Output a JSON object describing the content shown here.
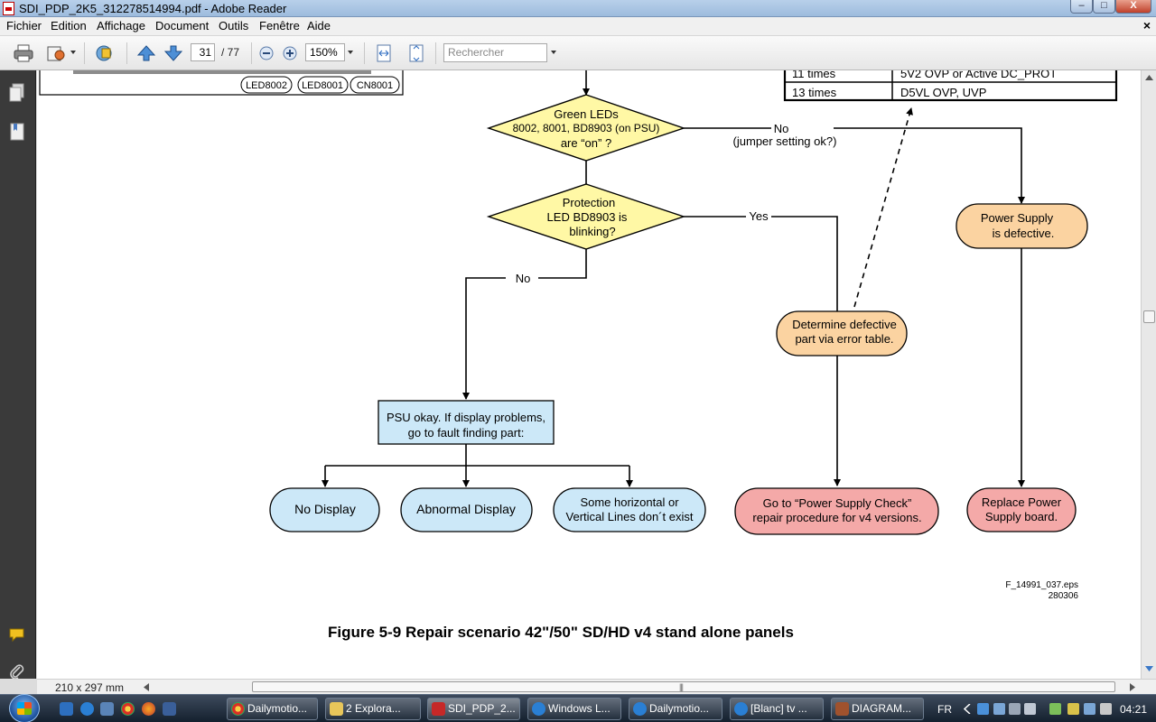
{
  "window": {
    "title": "SDI_PDP_2K5_312278514994.pdf - Adobe Reader",
    "min_label": "‒",
    "max_label": "□",
    "close_label": "X"
  },
  "menu": {
    "items": [
      "Fichier",
      "Edition",
      "Affichage",
      "Document",
      "Outils",
      "Fenêtre",
      "Aide"
    ],
    "close_label": "×"
  },
  "toolbar": {
    "page_current": "31",
    "page_total": "/ 77",
    "zoom": "150%",
    "search_placeholder": "Rechercher"
  },
  "document": {
    "top_table": [
      {
        "count": "11 times",
        "desc": "5V2 OVP or Active DC_PROT"
      },
      {
        "count": "13 times",
        "desc": "D5VL OVP, UVP"
      }
    ],
    "led_labels": [
      "LED8002",
      "LED8001",
      "CN8001"
    ],
    "diamond_green": [
      "Green LEDs",
      "8002, 8001, BD8903 (on PSU)",
      "are “on” ?"
    ],
    "diamond_protection": [
      "Protection",
      "LED BD8903 is",
      "blinking?"
    ],
    "label_no_jumper": [
      "No",
      "(jumper setting ok?)"
    ],
    "label_yes": "Yes",
    "label_no": "No",
    "power_supply_defective": [
      "Power Supply",
      "is defective."
    ],
    "determine_defective": [
      "Determine defective",
      "part via error table."
    ],
    "psu_okay": [
      "PSU okay. If display problems,",
      "go to fault finding part:"
    ],
    "no_display": "No Display",
    "abnormal_display": "Abnormal Display",
    "lines": [
      "Some horizontal or",
      "Vertical Lines don´t exist"
    ],
    "go_to_check": [
      "Go to “Power Supply Check”",
      "repair procedure for v4 versions."
    ],
    "replace_board": [
      "Replace Power",
      "Supply  board."
    ],
    "file_ref": [
      "F_14991_037.eps",
      "280306"
    ],
    "caption": "Figure 5-9 Repair scenario 42\"/50\" SD/HD v4 stand alone panels"
  },
  "colors": {
    "diamond": "#fff8a5",
    "orange": "#fbd3a1",
    "blue": "#cce8f8",
    "pink": "#f4a9a8"
  },
  "statusbar": {
    "page_size": "210 x 297 mm"
  },
  "taskbar": {
    "buttons": [
      "Dailymotio...",
      "2 Explora...",
      "SDI_PDP_2...",
      "Windows L...",
      "Dailymotio...",
      "[Blanc] tv ...",
      "DIAGRAM..."
    ],
    "lang": "FR",
    "clock": "04:21"
  }
}
